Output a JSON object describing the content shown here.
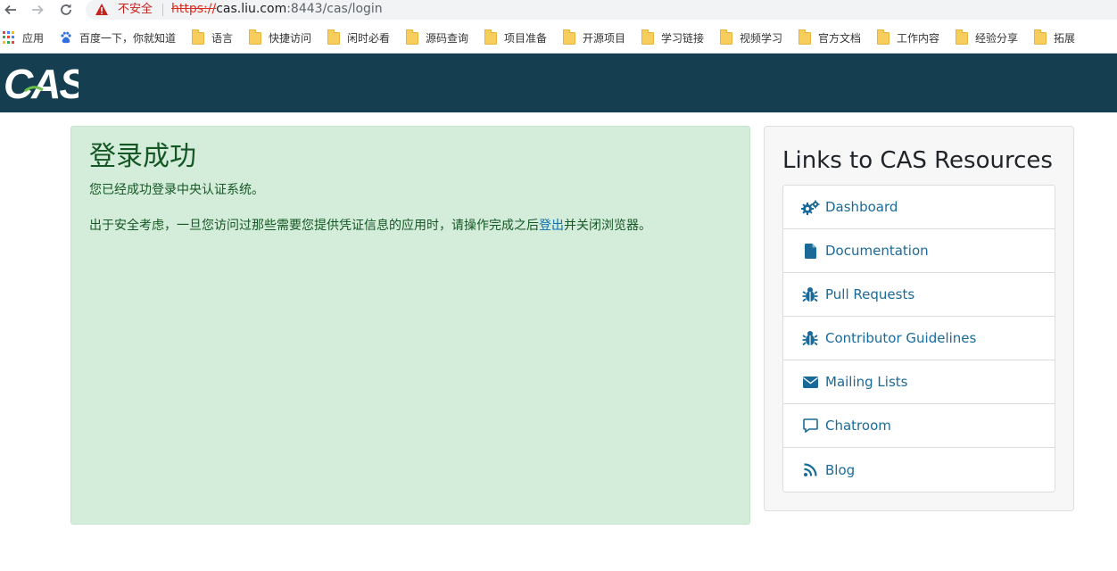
{
  "browser": {
    "security_label": "不安全",
    "url_scheme": "https://",
    "url_host": "cas.liu.com",
    "url_rest": ":8443/cas/login"
  },
  "bookmarks": [
    {
      "label": "应用",
      "icon": "apps-grid-icon"
    },
    {
      "label": "百度一下，你就知道",
      "icon": "baidu-paw-icon"
    },
    {
      "label": "语言",
      "icon": "folder-icon"
    },
    {
      "label": "快捷访问",
      "icon": "folder-icon"
    },
    {
      "label": "闲时必看",
      "icon": "folder-icon"
    },
    {
      "label": "源码查询",
      "icon": "folder-icon"
    },
    {
      "label": "项目准备",
      "icon": "folder-icon"
    },
    {
      "label": "开源项目",
      "icon": "folder-icon"
    },
    {
      "label": "学习链接",
      "icon": "folder-icon"
    },
    {
      "label": "视频学习",
      "icon": "folder-icon"
    },
    {
      "label": "官方文档",
      "icon": "folder-icon"
    },
    {
      "label": "工作内容",
      "icon": "folder-icon"
    },
    {
      "label": "经验分享",
      "icon": "folder-icon"
    },
    {
      "label": "拓展",
      "icon": "folder-icon"
    }
  ],
  "header": {
    "logo_text": "CAS"
  },
  "success": {
    "title": "登录成功",
    "message": "您已经成功登录中央认证系统。",
    "security_before": "出于安全考虑，一旦您访问过那些需要您提供凭证信息的应用时，请操作完成之后",
    "logout_link": "登出",
    "security_after": "并关闭浏览器。"
  },
  "resources": {
    "title": "Links to CAS Resources",
    "items": [
      {
        "label": "Dashboard",
        "icon": "cogs-icon"
      },
      {
        "label": "Documentation",
        "icon": "file-icon"
      },
      {
        "label": "Pull Requests",
        "icon": "bug-icon"
      },
      {
        "label": "Contributor Guidelines",
        "icon": "bug-icon"
      },
      {
        "label": "Mailing Lists",
        "icon": "envelope-icon"
      },
      {
        "label": "Chatroom",
        "icon": "comment-icon"
      },
      {
        "label": "Blog",
        "icon": "rss-icon"
      }
    ]
  },
  "colors": {
    "header_bg": "#153e50",
    "success_bg": "#d4edda",
    "success_text": "#155724",
    "link": "#1a6a99"
  }
}
